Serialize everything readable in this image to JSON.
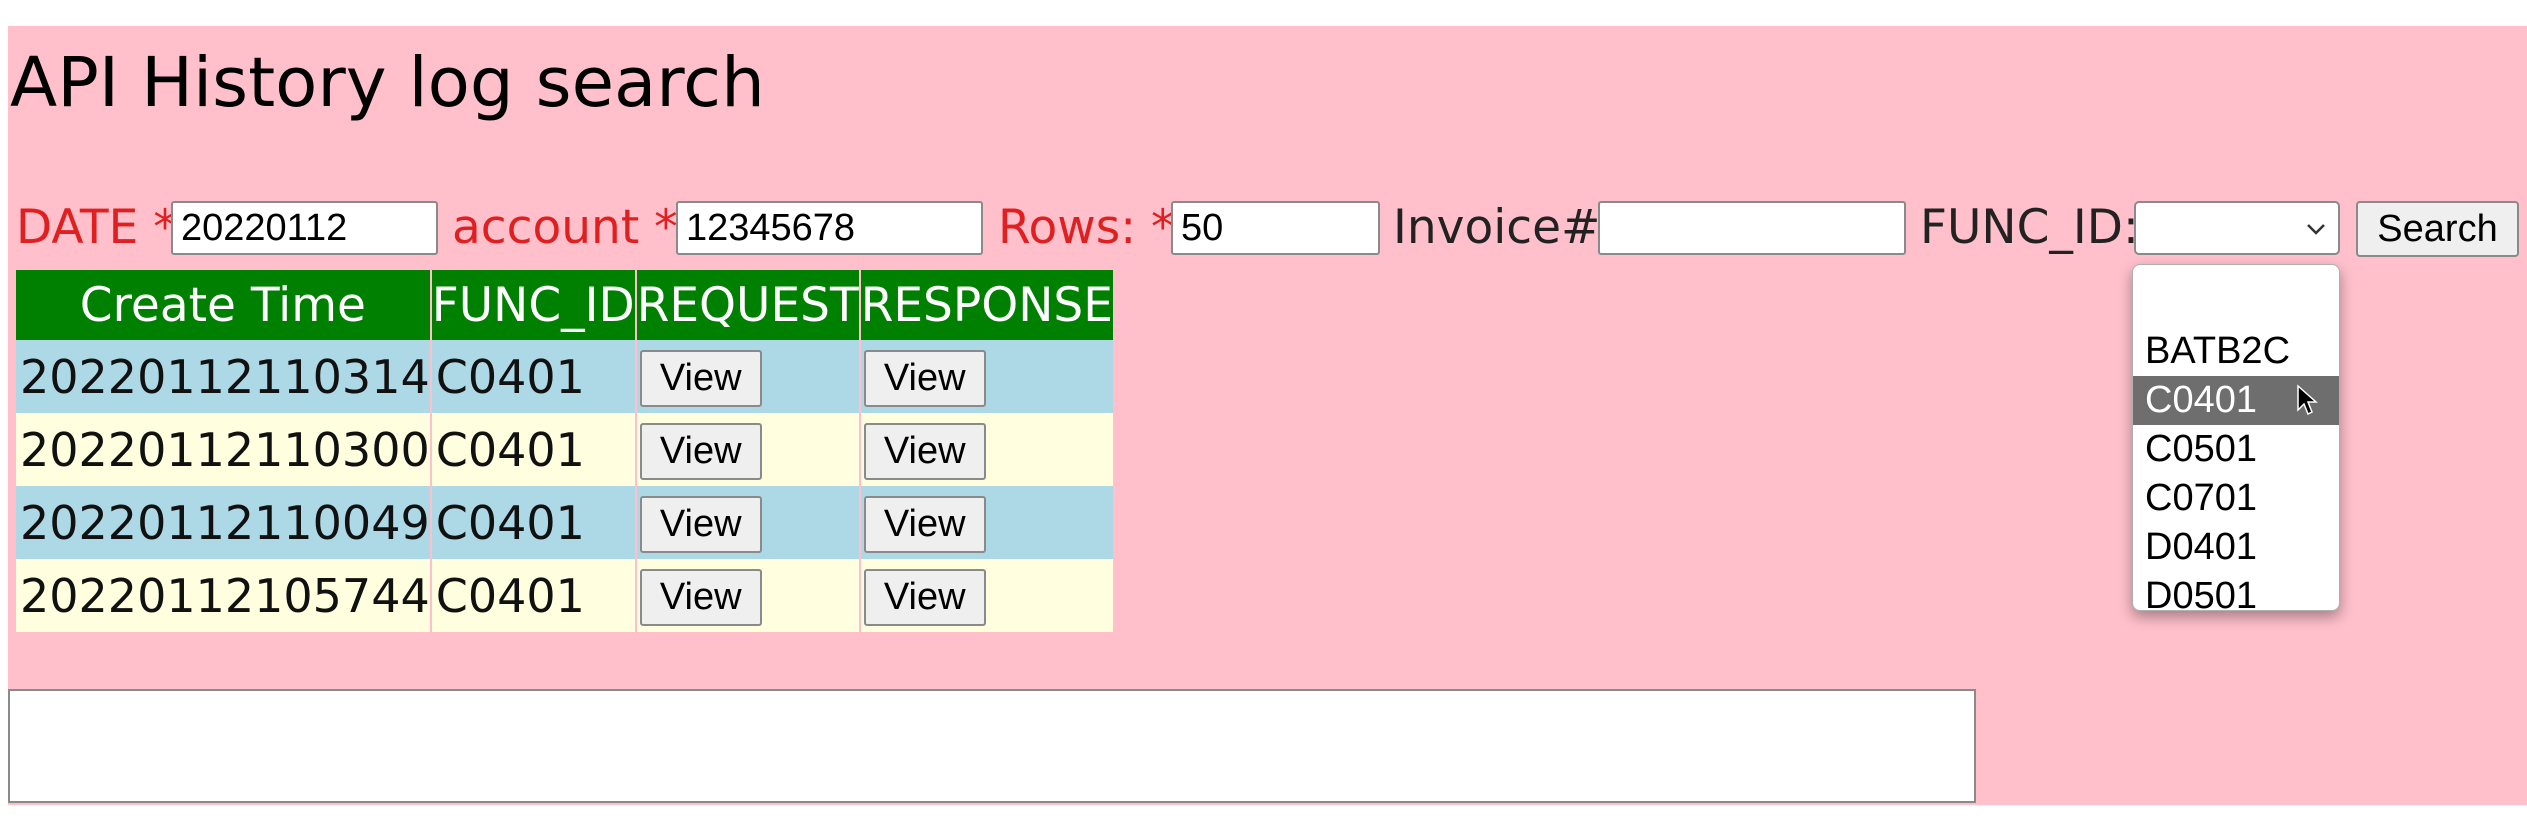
{
  "page": {
    "title": "API History log search",
    "background_color": "#ffc0cb"
  },
  "form": {
    "date_label": "DATE *",
    "date_value": "20220112",
    "account_label": "account *",
    "account_value": "12345678",
    "rows_label": "Rows: *",
    "rows_value": "50",
    "invoice_label": "Invoice#:",
    "invoice_value": "",
    "func_id_label": "FUNC_ID:",
    "func_id_selected": "",
    "search_label": "Search",
    "required_color": "#e02020"
  },
  "table": {
    "header_color": "#008000",
    "row_colors": [
      "#add8e6",
      "#ffffe0"
    ],
    "columns": [
      "Create Time",
      "FUNC_ID",
      "REQUEST",
      "RESPONSE"
    ],
    "rows": [
      {
        "create_time": "20220112110314",
        "func_id": "C0401",
        "request_label": "View",
        "response_label": "View"
      },
      {
        "create_time": "20220112110300",
        "func_id": "C0401",
        "request_label": "View",
        "response_label": "View"
      },
      {
        "create_time": "20220112110049",
        "func_id": "C0401",
        "request_label": "View",
        "response_label": "View"
      },
      {
        "create_time": "20220112105744",
        "func_id": "C0401",
        "request_label": "View",
        "response_label": "View"
      }
    ]
  },
  "output": {
    "text": ""
  },
  "func_id_dropdown": {
    "options": [
      "",
      "BATB2C",
      "C0401",
      "C0501",
      "C0701",
      "D0401",
      "D0501"
    ],
    "highlighted": "C0401"
  }
}
